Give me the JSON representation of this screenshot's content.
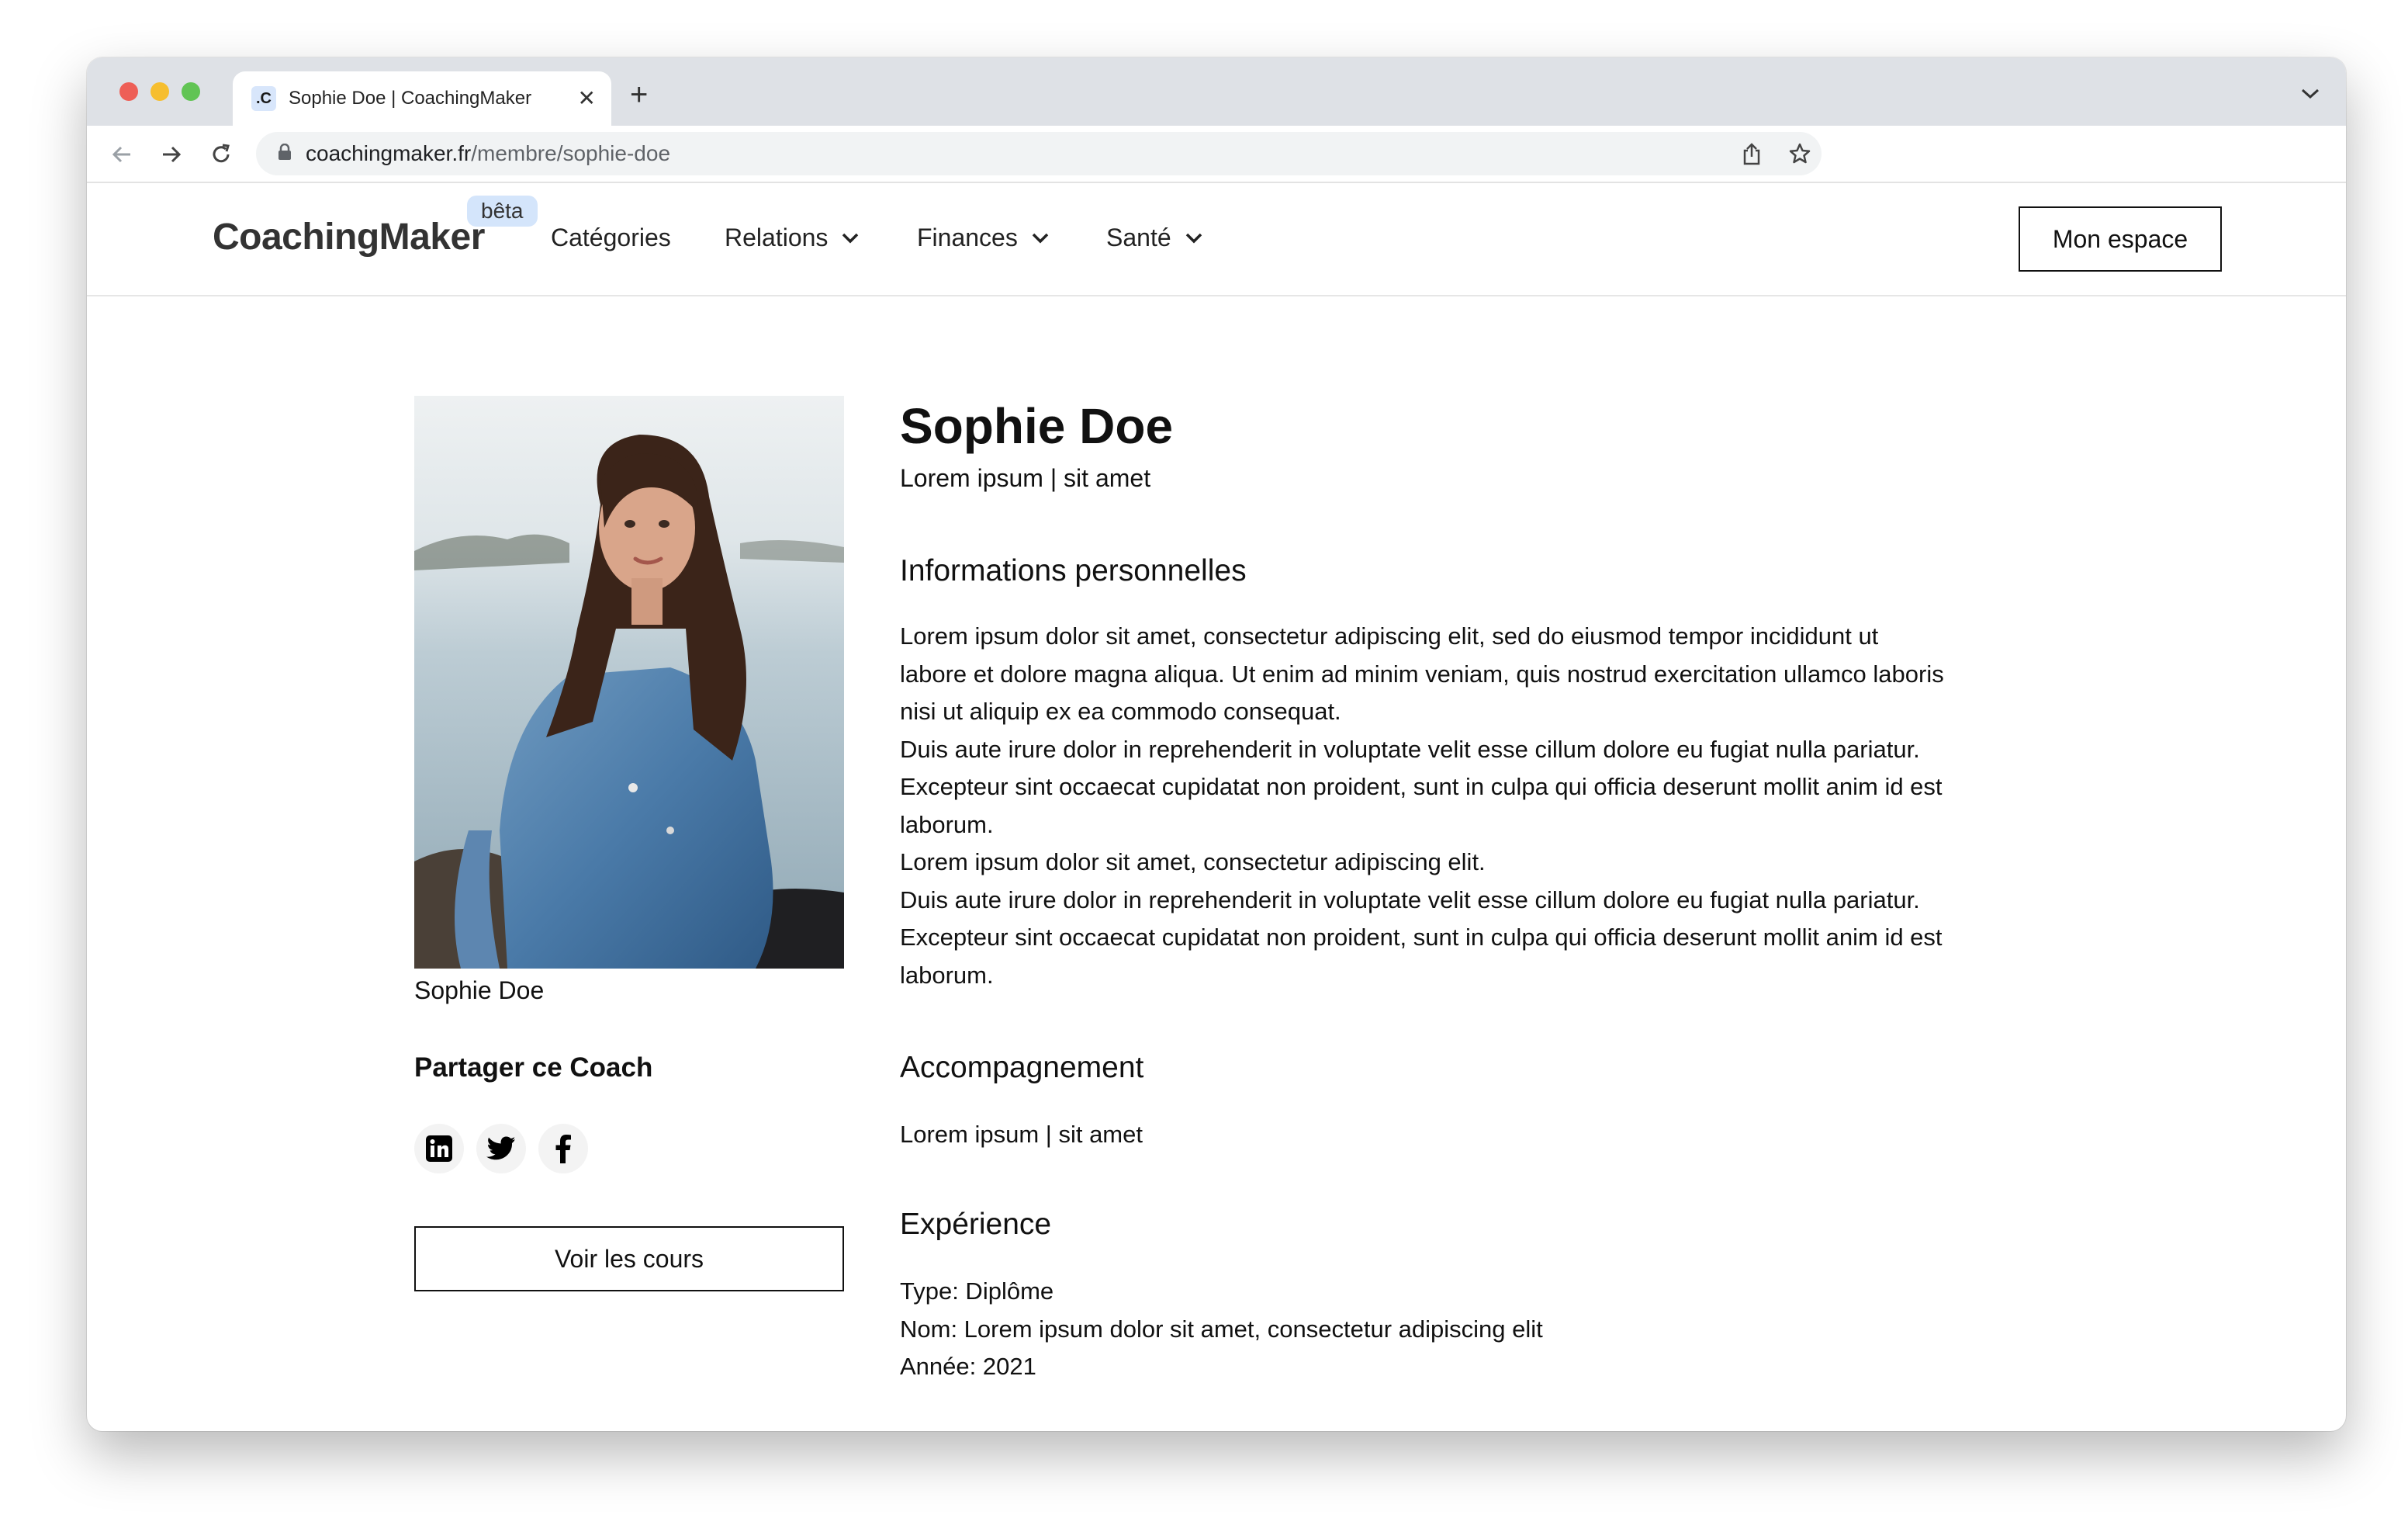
{
  "browser": {
    "tab_favicon": ".C",
    "tab_title": "Sophie Doe | CoachingMaker",
    "url_host": "coachingmaker.fr",
    "url_path": "/membre/sophie-doe"
  },
  "header": {
    "logo": "CoachingMaker",
    "beta_badge": "bêta",
    "nav": {
      "categories": "Catégories",
      "relations": "Relations",
      "finances": "Finances",
      "sante": "Santé"
    },
    "account_button": "Mon espace"
  },
  "sidebar": {
    "photo_caption": "Sophie Doe",
    "share_title": "Partager ce Coach",
    "share_icons": [
      "linkedin-icon",
      "twitter-icon",
      "facebook-icon"
    ],
    "courses_button": "Voir les cours"
  },
  "profile": {
    "name": "Sophie Doe",
    "subtitle": "Lorem ipsum | sit amet",
    "personal_info": {
      "title": "Informations personnelles",
      "lines": [
        "Lorem ipsum dolor sit amet, consectetur adipiscing elit, sed do eiusmod tempor incididunt ut",
        "labore et dolore magna aliqua. Ut enim ad minim veniam, quis nostrud exercitation ullamco laboris",
        "nisi ut aliquip ex ea commodo consequat.",
        "Duis aute irure dolor in reprehenderit in voluptate velit esse cillum dolore eu fugiat nulla pariatur.",
        "Excepteur sint occaecat cupidatat non proident, sunt in culpa qui officia deserunt mollit anim id est",
        "laborum.",
        "Lorem ipsum dolor sit amet, consectetur adipiscing elit.",
        "Duis aute irure dolor in reprehenderit in voluptate velit esse cillum dolore eu fugiat nulla pariatur.",
        "Excepteur sint occaecat cupidatat non proident, sunt in culpa qui officia deserunt mollit anim id est",
        "laborum."
      ]
    },
    "accompagnement": {
      "title": "Accompagnement",
      "text": "Lorem ipsum | sit amet"
    },
    "experience": {
      "title": "Expérience",
      "type": "Type: Diplôme",
      "nom": "Nom: Lorem ipsum dolor sit amet, consectetur adipiscing elit",
      "annee": "Année: 2021"
    }
  }
}
